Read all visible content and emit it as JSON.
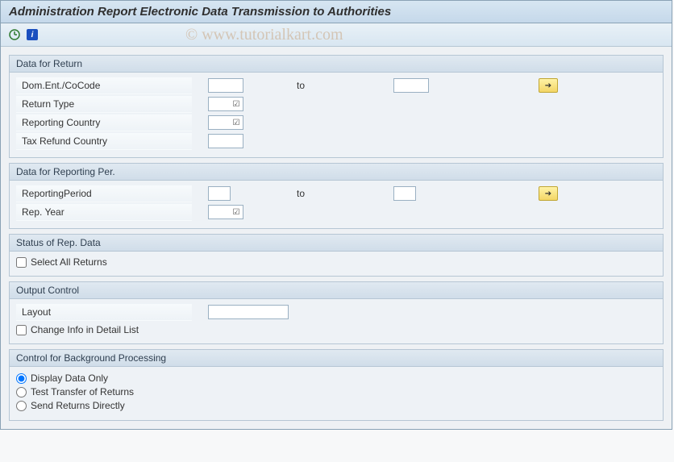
{
  "title": "Administration Report Electronic Data Transmission to Authorities",
  "watermark": "© www.tutorialkart.com",
  "toolbar": {
    "icons": [
      "execute",
      "info"
    ]
  },
  "groups": {
    "return": {
      "title": "Data for Return",
      "rows": {
        "cocode": {
          "label": "Dom.Ent./CoCode",
          "from": "",
          "to_label": "to",
          "to": ""
        },
        "rtype": {
          "label": "Return Type",
          "value": ""
        },
        "rcountry": {
          "label": "Reporting Country",
          "value": ""
        },
        "trefund": {
          "label": "Tax Refund Country",
          "value": ""
        }
      }
    },
    "period": {
      "title": "Data for Reporting Per.",
      "rows": {
        "rperiod": {
          "label": "ReportingPeriod",
          "from": "",
          "to_label": "to",
          "to": ""
        },
        "ryear": {
          "label": "Rep. Year",
          "value": ""
        }
      }
    },
    "status": {
      "title": "Status of Rep. Data",
      "select_all": {
        "label": "Select All Returns",
        "checked": false
      }
    },
    "output": {
      "title": "Output Control",
      "layout": {
        "label": "Layout",
        "value": ""
      },
      "change_info": {
        "label": "Change Info in Detail List",
        "checked": false
      }
    },
    "bg": {
      "title": "Control for Background Processing",
      "options": {
        "display": "Display Data Only",
        "test": "Test Transfer of Returns",
        "send": "Send Returns Directly"
      },
      "selected": "display"
    }
  }
}
